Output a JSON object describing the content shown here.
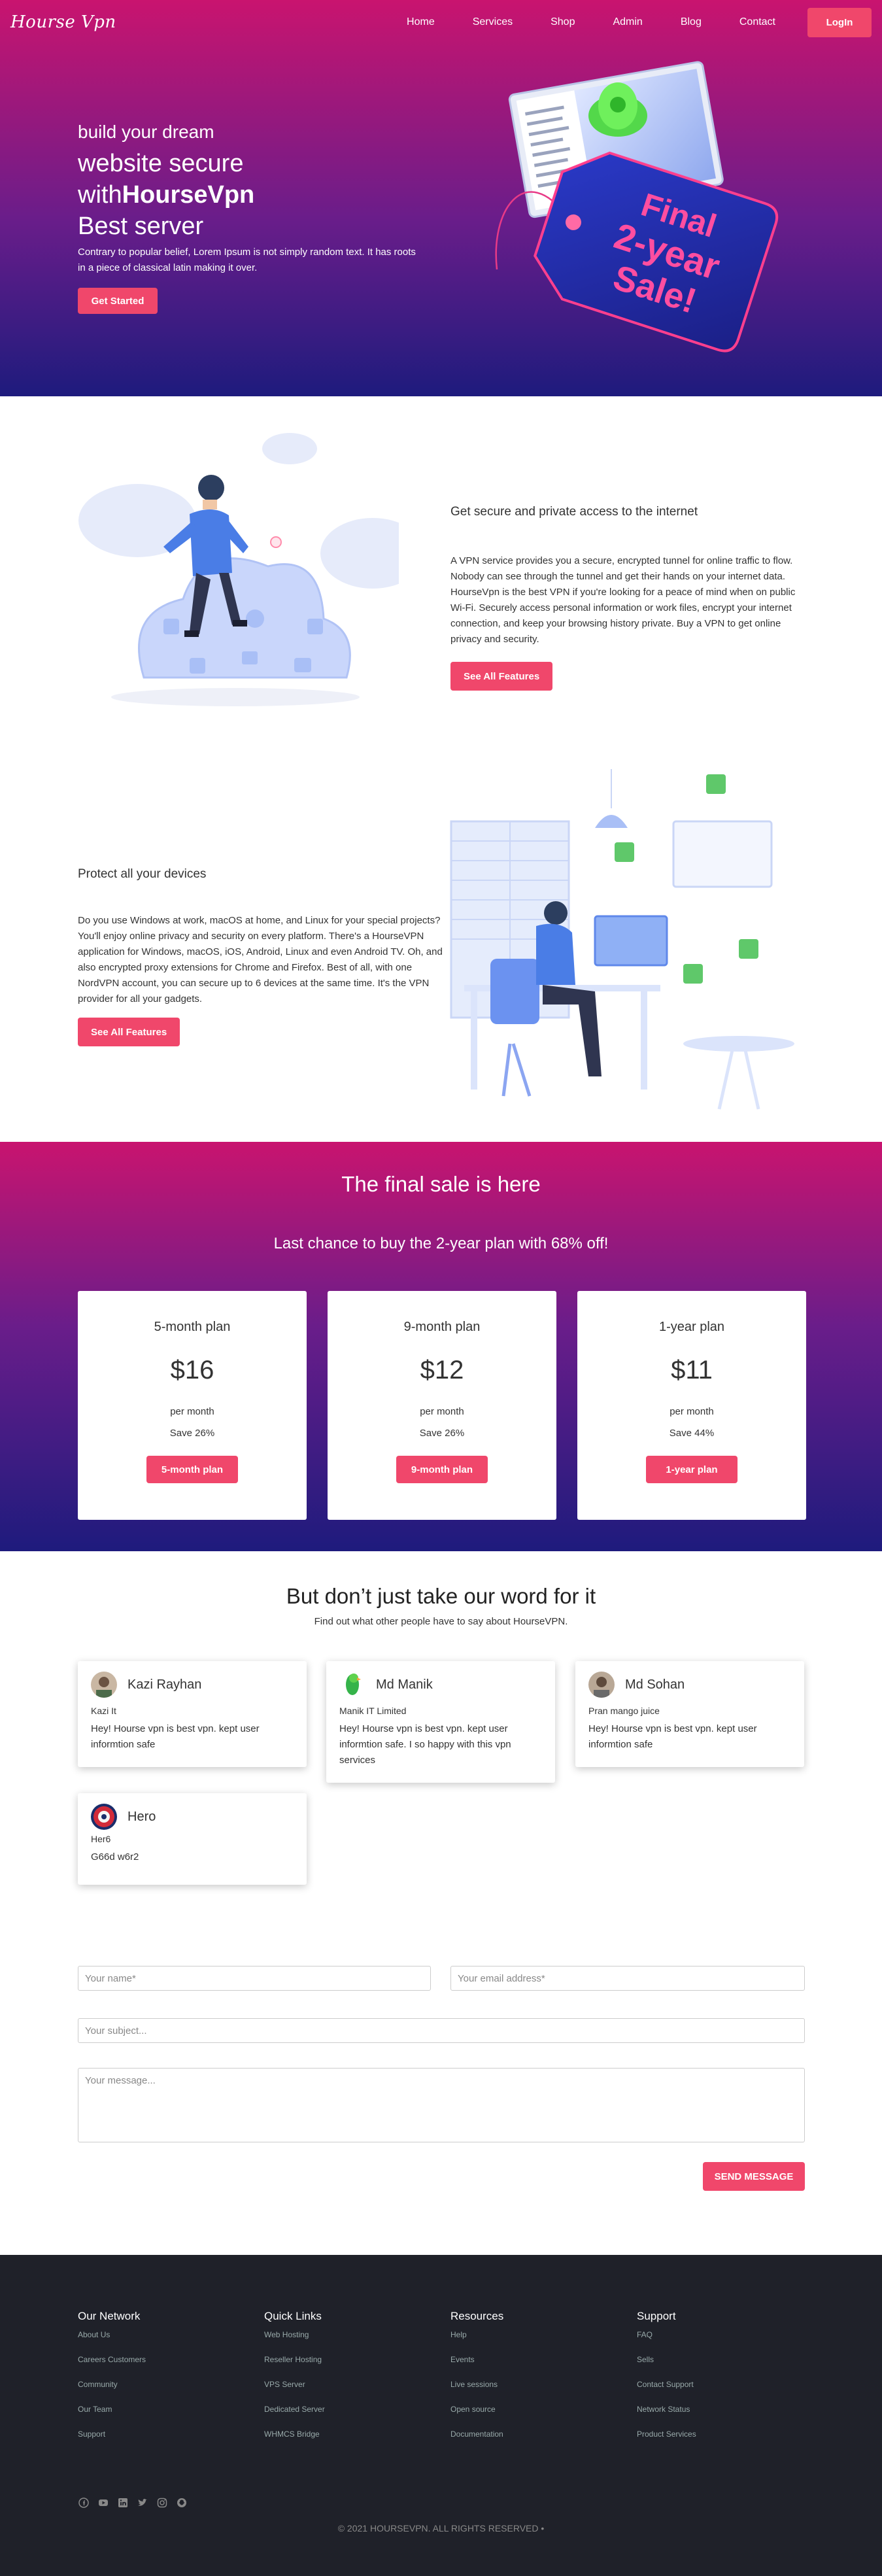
{
  "nav": {
    "brand": "Hourse Vpn",
    "links": [
      "Home",
      "Services",
      "Shop",
      "Admin",
      "Blog",
      "Contact"
    ],
    "login_label": "LogIn"
  },
  "hero": {
    "line1": "build your dream",
    "line2_prefix": "website secure",
    "line2b_prefix": "with",
    "line2b_bold": "HourseVpn",
    "line3": "Best server",
    "paragraph": "Contrary to popular belief, Lorem Ipsum is not simply random text. It has roots in a piece of classical latin making it over.",
    "cta": "Get Started",
    "tag_line1": "Final",
    "tag_line2": "2-year",
    "tag_line3": "Sale!"
  },
  "feature1": {
    "title": "Get secure and private access to the internet",
    "body": "A VPN service provides you a secure, encrypted tunnel for online traffic to flow. Nobody can see through the tunnel and get their hands on your internet data. HourseVpn is the best VPN if you're looking for a peace of mind when on public Wi-Fi. Securely access personal information or work files, encrypt your internet connection, and keep your browsing history private. Buy a VPN to get online privacy and security.",
    "cta": "See All Features"
  },
  "feature2": {
    "title": "Protect all your devices",
    "body": "Do you use Windows at work, macOS at home, and Linux for your special projects? You'll enjoy online privacy and security on every platform. There's a HourseVPN application for Windows, macOS, iOS, Android, Linux and even Android TV. Oh, and also encrypted proxy extensions for Chrome and Firefox. Best of all, with one NordVPN account, you can secure up to 6 devices at the same time. It's the VPN provider for all your gadgets.",
    "cta": "See All Features"
  },
  "pricing": {
    "title": "The final sale is here",
    "subtitle": "Last chance to buy the 2-year plan with 68% off!",
    "plans": [
      {
        "name": "5-month plan",
        "price": "$16",
        "per": "per month",
        "save": "Save 26%",
        "cta": "5-month plan"
      },
      {
        "name": "9-month plan",
        "price": "$12",
        "per": "per month",
        "save": "Save 26%",
        "cta": "9-month plan"
      },
      {
        "name": "1-year plan",
        "price": "$11",
        "per": "per month",
        "save": "Save 44%",
        "cta": "1-year plan"
      }
    ]
  },
  "testimonials": {
    "title": "But don’t just take our word for it",
    "subtitle": "Find out what other people have to say about HourseVPN.",
    "items": [
      {
        "name": "Kazi Rayhan",
        "role": "Kazi It",
        "text": "Hey! Hourse vpn is best vpn. kept user informtion safe"
      },
      {
        "name": "Md Manik",
        "role": "Manik IT Limited",
        "text": "Hey! Hourse vpn is best vpn. kept user informtion safe. I so happy with this vpn services"
      },
      {
        "name": "Md Sohan",
        "role": "Pran mango juice",
        "text": "Hey! Hourse vpn is best vpn. kept user informtion safe"
      },
      {
        "name": "Hero",
        "role": "Her6",
        "text": "G66d w6r2"
      }
    ]
  },
  "contact": {
    "name_placeholder": "Your name*",
    "email_placeholder": "Your email address*",
    "subject_placeholder": "Your subject...",
    "message_placeholder": "Your message...",
    "send_label": "SEND MESSAGE"
  },
  "footer": {
    "columns": [
      {
        "title": "Our Network",
        "items": [
          "About Us",
          "Careers Customers",
          "Community",
          "Our Team",
          "Support"
        ]
      },
      {
        "title": "Quick Links",
        "items": [
          "Web Hosting",
          "Reseller Hosting",
          "VPS Server",
          "Dedicated Server",
          "WHMCS Bridge"
        ]
      },
      {
        "title": "Resources",
        "items": [
          "Help",
          "Events",
          "Live sessions",
          "Open source",
          "Documentation"
        ]
      },
      {
        "title": "Support",
        "items": [
          "FAQ",
          "Sells",
          "Contact Support",
          "Network Status",
          "Product Services"
        ]
      }
    ],
    "socials": [
      "facebook-icon",
      "youtube-icon",
      "linkedin-icon",
      "twitter-icon",
      "instagram-icon",
      "snapchat-icon"
    ],
    "copyright": "© 2021 HOURSEVPN. ALL RIGHTS RESERVED •"
  },
  "colors": {
    "accent": "#f0476b",
    "gradient_top": "#c9146f",
    "gradient_bottom": "#1e1b7d",
    "footer_bg": "#1f2129"
  }
}
